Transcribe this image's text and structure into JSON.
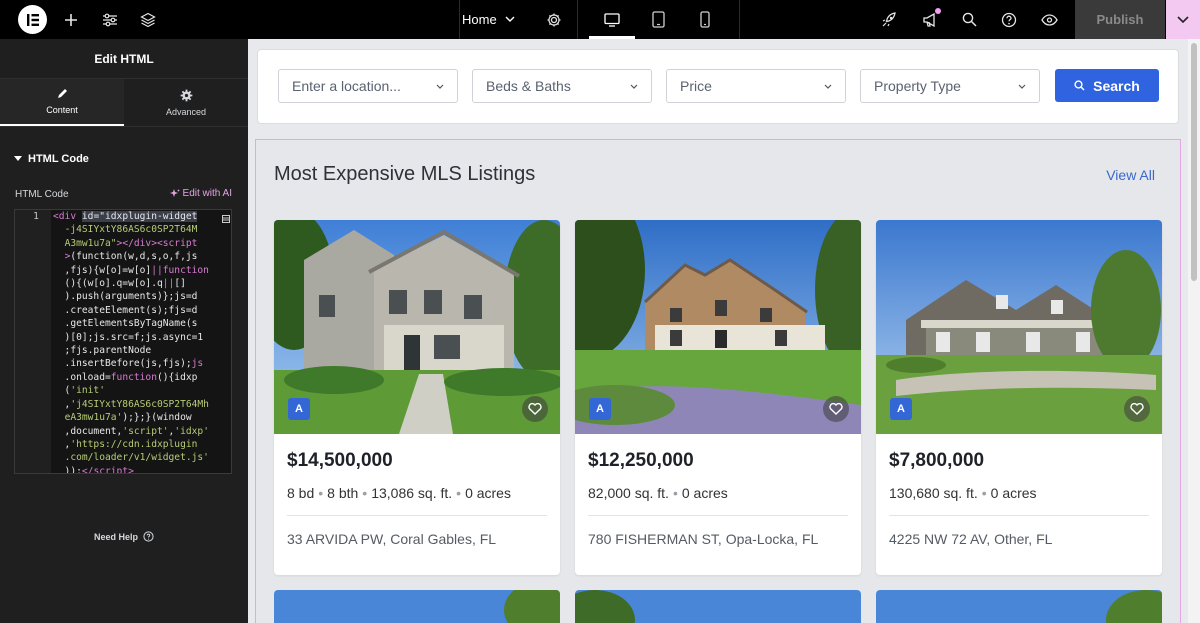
{
  "topbar": {
    "page_name": "Home",
    "publish_label": "Publish"
  },
  "panel": {
    "title": "Edit HTML",
    "tabs": [
      {
        "label": "Content",
        "icon": "pencil-icon"
      },
      {
        "label": "Advanced",
        "icon": "gear-icon"
      }
    ],
    "section_title": "HTML Code",
    "field_label": "HTML Code",
    "edit_ai_label": "Edit with AI",
    "line_number": "1",
    "need_help": "Need Help"
  },
  "search": {
    "location_placeholder": "Enter a location...",
    "beds_label": "Beds & Baths",
    "price_label": "Price",
    "type_label": "Property Type",
    "button_label": "Search"
  },
  "listings": {
    "title": "Most Expensive MLS Listings",
    "view_all": "View All",
    "cards": [
      {
        "badge": "A",
        "price": "$14,500,000",
        "beds": "8 bd",
        "baths": "8 bth",
        "sqft": "13,086 sq. ft.",
        "acres": "0 acres",
        "address": "33 ARVIDA PW, Coral Gables, FL"
      },
      {
        "badge": "A",
        "price": "$12,250,000",
        "sqft": "82,000 sq. ft.",
        "acres": "0 acres",
        "address": "780 FISHERMAN ST, Opa-Locka, FL"
      },
      {
        "badge": "A",
        "price": "$7,800,000",
        "sqft": "130,680 sq. ft.",
        "acres": "0 acres",
        "address": "4225 NW 72 AV, Other, FL"
      }
    ]
  },
  "colors": {
    "accent": "#2f63e0",
    "highlight": "#f3c9f2",
    "badge": "#3367d6"
  }
}
